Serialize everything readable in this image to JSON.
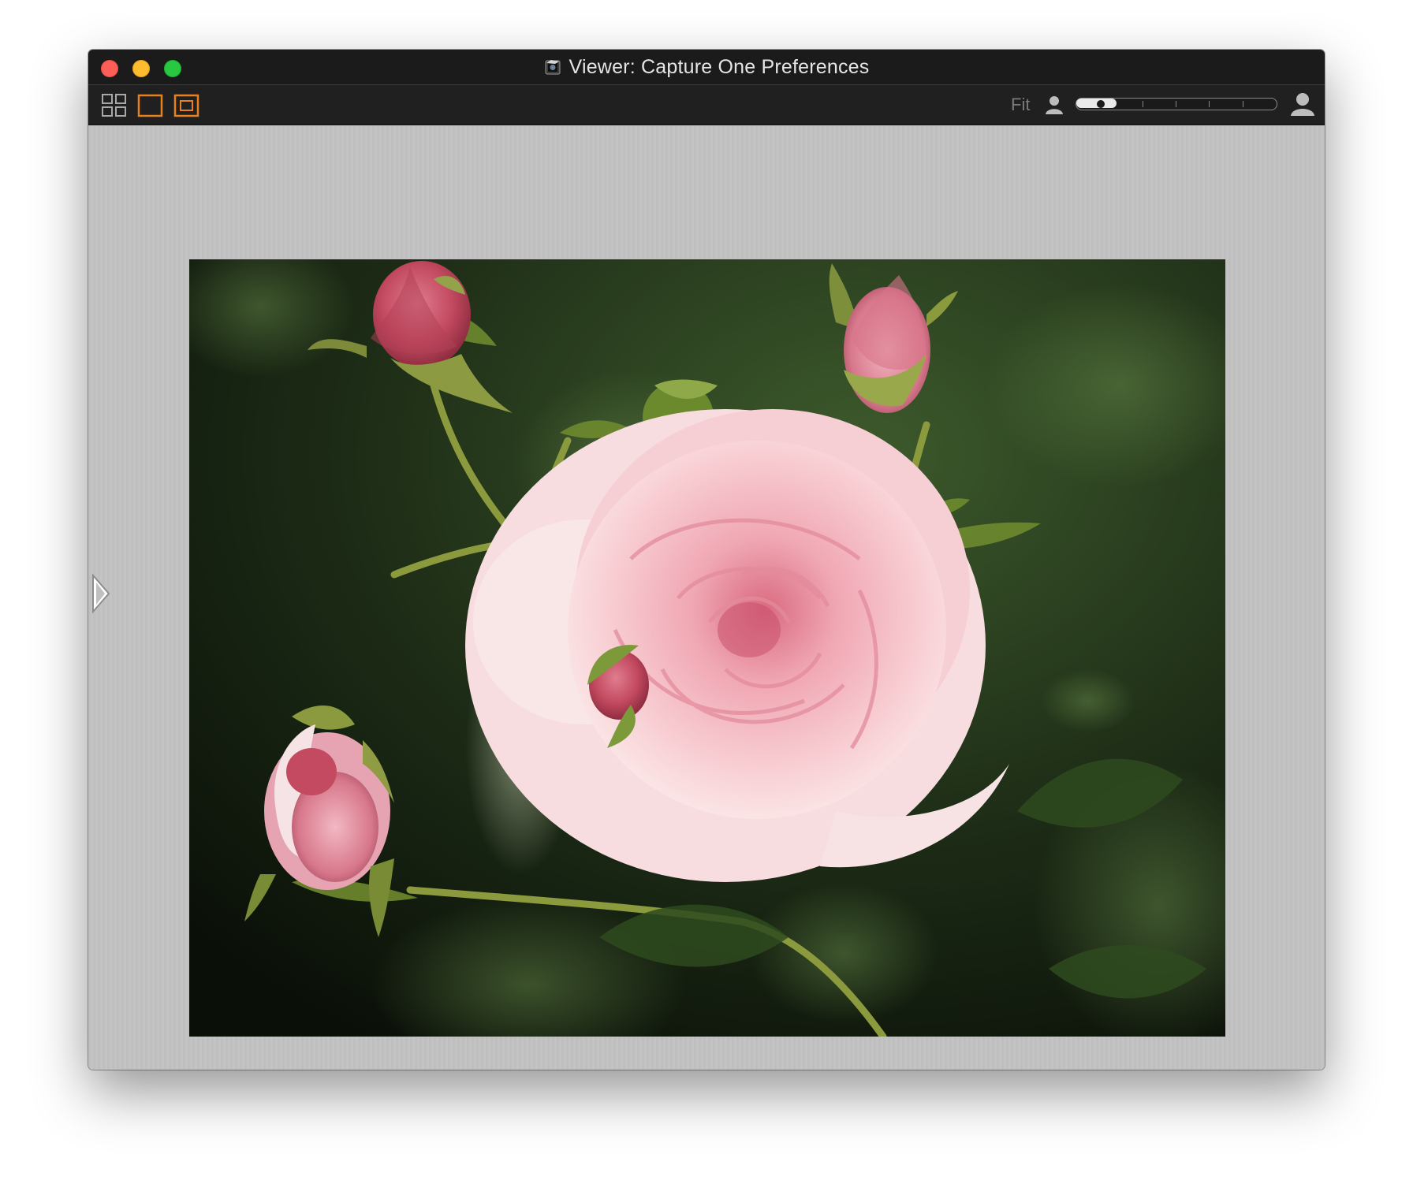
{
  "window": {
    "title": "Viewer: Capture One Preferences",
    "traffic_lights": {
      "close": "#fc5f57",
      "minimize": "#fdbc2e",
      "zoom": "#28c840"
    }
  },
  "toolbar": {
    "view_modes": [
      {
        "name": "grid-view",
        "icon": "grid-icon",
        "active": false
      },
      {
        "name": "single-view",
        "icon": "single-frame-icon",
        "active": true
      },
      {
        "name": "framed-view",
        "icon": "framed-frame-icon",
        "active": true
      }
    ],
    "zoom_label": "Fit",
    "size_slider": {
      "value_fraction": 0.2,
      "ticks": 6
    },
    "accent_color": "#e8801e"
  },
  "viewer": {
    "background": "#c0c0c0",
    "image_subject": "pink-rose-photo"
  }
}
